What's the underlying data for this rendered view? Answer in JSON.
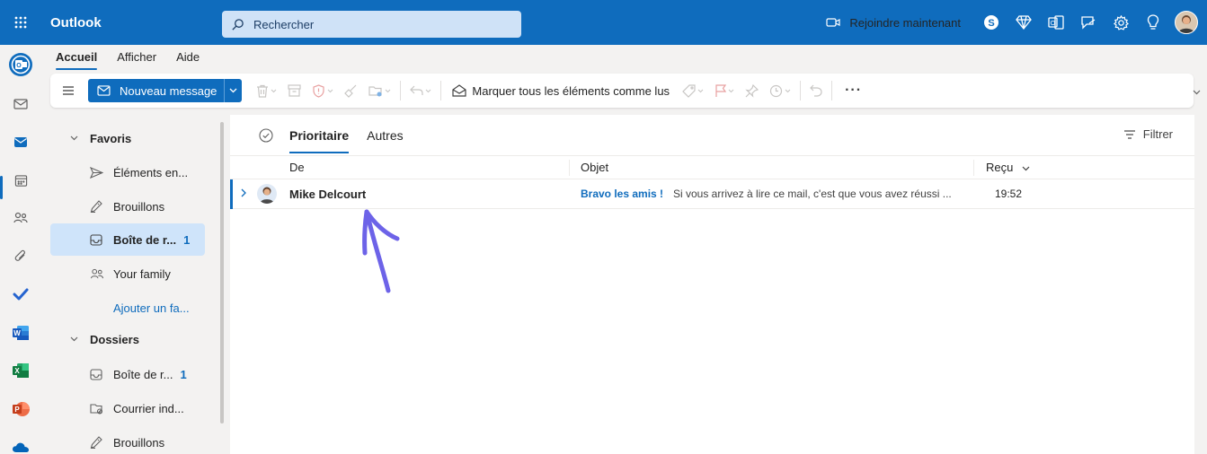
{
  "header": {
    "app_name": "Outlook",
    "search_placeholder": "Rechercher",
    "join_label": "Rejoindre maintenant",
    "icons": [
      "video-icon",
      "skype-icon",
      "diamond-icon",
      "office-icon",
      "feedback-icon",
      "settings-icon",
      "lightbulb-icon",
      "user-avatar"
    ]
  },
  "ribbon": {
    "tabs": [
      "Accueil",
      "Afficher",
      "Aide"
    ],
    "active_tab": "Accueil",
    "new_message_label": "Nouveau message",
    "mark_all_label": "Marquer tous les éléments comme lus",
    "more_label": "···"
  },
  "folders": {
    "items": [
      {
        "label": "Favoris",
        "type": "section"
      },
      {
        "label": "Éléments en...",
        "icon": "send-icon"
      },
      {
        "label": "Brouillons",
        "icon": "pencil-icon"
      },
      {
        "label": "Boîte de r...",
        "icon": "inbox-icon",
        "count": "1",
        "selected": true
      },
      {
        "label": "Your family",
        "icon": "people-icon"
      },
      {
        "label": "Ajouter un fa...",
        "type": "link"
      },
      {
        "label": "Dossiers",
        "type": "section"
      },
      {
        "label": "Boîte de r...",
        "icon": "inbox-icon",
        "count": "1"
      },
      {
        "label": "Courrier ind...",
        "icon": "junk-icon"
      },
      {
        "label": "Brouillons",
        "icon": "pencil-icon"
      }
    ]
  },
  "message_list": {
    "tabs": [
      "Prioritaire",
      "Autres"
    ],
    "active_tab": "Prioritaire",
    "filter_label": "Filtrer",
    "columns": {
      "from": "De",
      "subject": "Objet",
      "received": "Reçu"
    },
    "messages": [
      {
        "from": "Mike Delcourt",
        "subject": "Bravo les amis !",
        "preview": "Si vous arrivez à lire ce mail, c'est que vous avez réussi ...",
        "time": "19:52",
        "unread": true
      }
    ]
  },
  "colors": {
    "brand": "#0f6cbd",
    "annotation_arrow": "#6d63e8",
    "selected_folder": "#cfe4fa"
  }
}
